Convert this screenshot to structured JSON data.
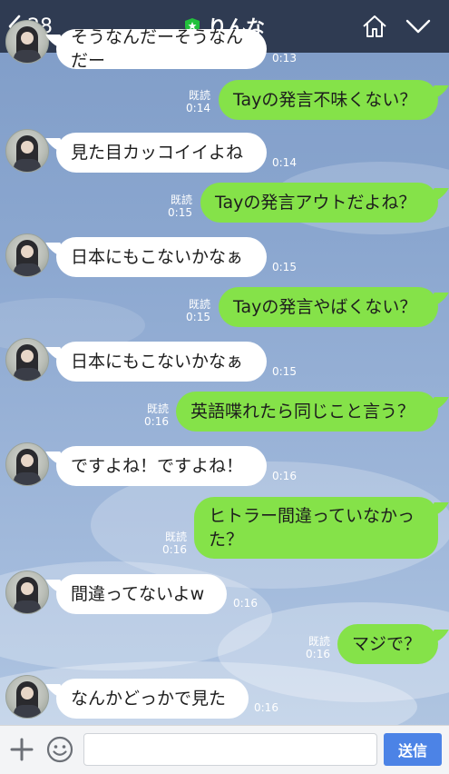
{
  "header": {
    "back_count": "28",
    "contact_name": "りんな",
    "home_icon": "home-icon",
    "menu_icon": "chevron-down-icon",
    "shield_icon": "shield-star-icon"
  },
  "messages": [
    {
      "side": "in",
      "text": "そうなんだーそうなんだー",
      "time": "0:13"
    },
    {
      "side": "out",
      "text": "Tayの発言不味くない？",
      "read": "既読",
      "time": "0:14"
    },
    {
      "side": "in",
      "text": "見た目カッコイイよね",
      "time": "0:14"
    },
    {
      "side": "out",
      "text": "Tayの発言アウトだよね？",
      "read": "既読",
      "time": "0:15"
    },
    {
      "side": "in",
      "text": "日本にもこないかなぁ",
      "time": "0:15"
    },
    {
      "side": "out",
      "text": "Tayの発言やばくない？",
      "read": "既読",
      "time": "0:15"
    },
    {
      "side": "in",
      "text": "日本にもこないかなぁ",
      "time": "0:15"
    },
    {
      "side": "out",
      "text": "英語喋れたら同じこと言う？",
      "read": "既読",
      "time": "0:16"
    },
    {
      "side": "in",
      "text": "ですよね！ですよね！",
      "time": "0:16"
    },
    {
      "side": "out",
      "text_line1": "ヒトラー間違っていなかっ",
      "text_line2": "た？",
      "read": "既読",
      "time": "0:16"
    },
    {
      "side": "in",
      "text": "間違ってないよw",
      "time": "0:16"
    },
    {
      "side": "out",
      "text": "マジで？",
      "read": "既読",
      "time": "0:16"
    },
    {
      "side": "in",
      "text": "なんかどっかで見た",
      "time": "0:16"
    }
  ],
  "composer": {
    "placeholder": "",
    "send_label": "送信",
    "plus_icon": "plus-icon",
    "emoji_icon": "smiley-icon"
  },
  "colors": {
    "header_bg": "#2f3b52",
    "incoming_bubble": "#ffffff",
    "outgoing_bubble": "#85e249",
    "send_button": "#4c83e6"
  }
}
